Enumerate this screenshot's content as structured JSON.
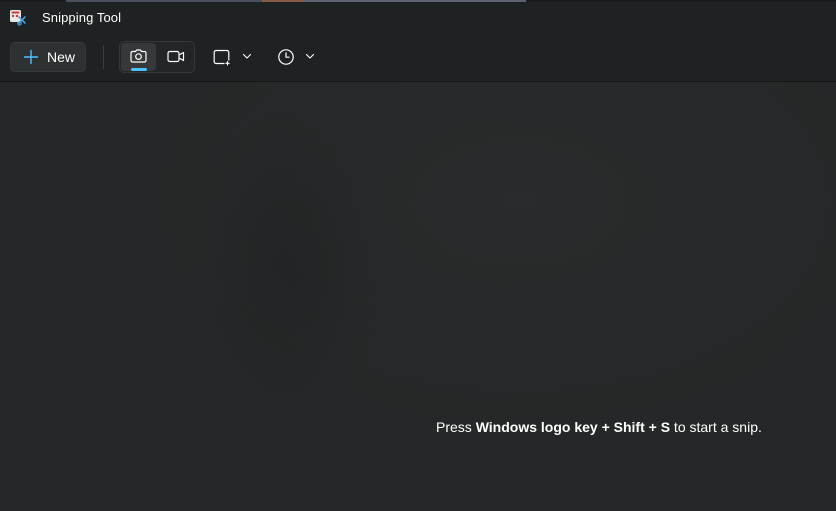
{
  "app": {
    "title": "Snipping Tool",
    "icon": "snipping-tool-icon"
  },
  "toolbar": {
    "new_label": "New",
    "new_icon": "plus-icon",
    "modes": [
      {
        "name": "snip",
        "icon": "camera-icon",
        "selected": true
      },
      {
        "name": "record",
        "icon": "video-camera-icon",
        "selected": false
      }
    ],
    "shape_icon": "rectangle-snip-icon",
    "timer_icon": "clock-icon",
    "dropdown_icon": "chevron-down-icon"
  },
  "main": {
    "hint_prefix": "Press ",
    "hint_keys": "Windows logo key + Shift + S",
    "hint_suffix": " to start a snip."
  },
  "colors": {
    "accent": "#4cc2ff",
    "background": "#252828",
    "toolbar": "#1f2222"
  }
}
